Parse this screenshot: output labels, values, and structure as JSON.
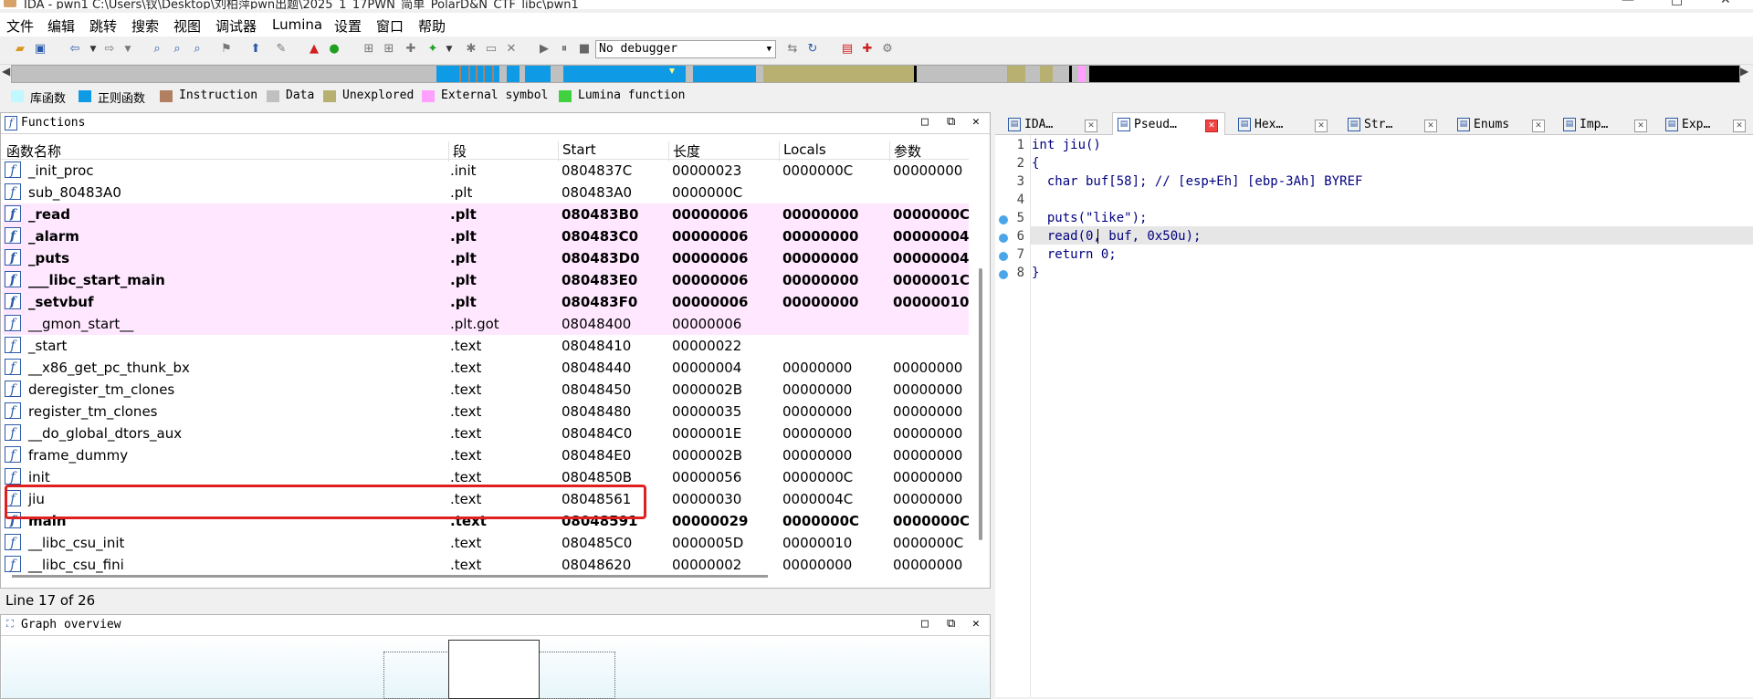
{
  "window": {
    "title": "IDA - pwn1 C:\\Users\\钗\\Desktop\\刘柏萍pwn出题\\2025_1_17PWN_简单_PolarD&N_CTF_libc\\pwn1",
    "min": "—",
    "max": "□",
    "close": "✕"
  },
  "menu": [
    "文件",
    "编辑",
    "跳转",
    "搜索",
    "视图",
    "调试器",
    "Lumina",
    "设置",
    "窗口",
    "帮助"
  ],
  "toolbar": {
    "debugger": "No debugger"
  },
  "legend": [
    {
      "label": "库函数",
      "color": "#bff8ff"
    },
    {
      "label": "正则函数",
      "color": "#0f9ae6"
    },
    {
      "label": "Instruction",
      "color": "#b08060"
    },
    {
      "label": "Data",
      "color": "#c0c0c0"
    },
    {
      "label": "Unexplored",
      "color": "#b8b070"
    },
    {
      "label": "External symbol",
      "color": "#ff9fff"
    },
    {
      "label": "Lumina function",
      "color": "#40d040"
    }
  ],
  "functions_panel": {
    "title": "Functions",
    "columns": [
      "函数名称",
      "段",
      "Start",
      "长度",
      "Locals",
      "参数"
    ],
    "rows": [
      {
        "name": "_init_proc",
        "seg": ".init",
        "start": "0804837C",
        "len": "00000023",
        "locals": "0000000C",
        "args": "00000000",
        "style": ""
      },
      {
        "name": "sub_80483A0",
        "seg": ".plt",
        "start": "080483A0",
        "len": "0000000C",
        "locals": "",
        "args": "",
        "style": ""
      },
      {
        "name": "_read",
        "seg": ".plt",
        "start": "080483B0",
        "len": "00000006",
        "locals": "00000000",
        "args": "0000000C",
        "style": "plt bold"
      },
      {
        "name": "_alarm",
        "seg": ".plt",
        "start": "080483C0",
        "len": "00000006",
        "locals": "00000000",
        "args": "00000004",
        "style": "plt bold"
      },
      {
        "name": "_puts",
        "seg": ".plt",
        "start": "080483D0",
        "len": "00000006",
        "locals": "00000000",
        "args": "00000004",
        "style": "plt bold"
      },
      {
        "name": "___libc_start_main",
        "seg": ".plt",
        "start": "080483E0",
        "len": "00000006",
        "locals": "00000000",
        "args": "0000001C",
        "style": "plt bold"
      },
      {
        "name": "_setvbuf",
        "seg": ".plt",
        "start": "080483F0",
        "len": "00000006",
        "locals": "00000000",
        "args": "00000010",
        "style": "plt bold"
      },
      {
        "name": "__gmon_start__",
        "seg": ".plt.got",
        "start": "08048400",
        "len": "00000006",
        "locals": "",
        "args": "",
        "style": "plt"
      },
      {
        "name": "_start",
        "seg": ".text",
        "start": "08048410",
        "len": "00000022",
        "locals": "",
        "args": "",
        "style": ""
      },
      {
        "name": "__x86_get_pc_thunk_bx",
        "seg": ".text",
        "start": "08048440",
        "len": "00000004",
        "locals": "00000000",
        "args": "00000000",
        "style": ""
      },
      {
        "name": "deregister_tm_clones",
        "seg": ".text",
        "start": "08048450",
        "len": "0000002B",
        "locals": "00000000",
        "args": "00000000",
        "style": ""
      },
      {
        "name": "register_tm_clones",
        "seg": ".text",
        "start": "08048480",
        "len": "00000035",
        "locals": "00000000",
        "args": "00000000",
        "style": ""
      },
      {
        "name": "__do_global_dtors_aux",
        "seg": ".text",
        "start": "080484C0",
        "len": "0000001E",
        "locals": "00000000",
        "args": "00000000",
        "style": ""
      },
      {
        "name": "frame_dummy",
        "seg": ".text",
        "start": "080484E0",
        "len": "0000002B",
        "locals": "00000000",
        "args": "00000000",
        "style": ""
      },
      {
        "name": "init",
        "seg": ".text",
        "start": "0804850B",
        "len": "00000056",
        "locals": "0000000C",
        "args": "00000000",
        "style": ""
      },
      {
        "name": "jiu",
        "seg": ".text",
        "start": "08048561",
        "len": "00000030",
        "locals": "0000004C",
        "args": "00000000",
        "style": ""
      },
      {
        "name": "main",
        "seg": ".text",
        "start": "08048591",
        "len": "00000029",
        "locals": "0000000C",
        "args": "0000000C",
        "style": "bold"
      },
      {
        "name": "__libc_csu_init",
        "seg": ".text",
        "start": "080485C0",
        "len": "0000005D",
        "locals": "00000010",
        "args": "0000000C",
        "style": ""
      },
      {
        "name": "__libc_csu_fini",
        "seg": ".text",
        "start": "08048620",
        "len": "00000002",
        "locals": "00000000",
        "args": "00000000",
        "style": ""
      }
    ],
    "status": "Line 17 of 26"
  },
  "graph_panel": {
    "title": "Graph overview"
  },
  "tabs": [
    {
      "label": "IDA…",
      "icon": "ida-view-icon",
      "active": false
    },
    {
      "label": "Pseud…",
      "icon": "pseudocode-icon",
      "active": true
    },
    {
      "label": "Hex…",
      "icon": "hex-view-icon",
      "active": false
    },
    {
      "label": "Str…",
      "icon": "strings-icon",
      "active": false
    },
    {
      "label": "Enums",
      "icon": "enums-icon",
      "active": false
    },
    {
      "label": "Imp…",
      "icon": "imports-icon",
      "active": false
    },
    {
      "label": "Exp…",
      "icon": "exports-icon",
      "active": false
    }
  ],
  "code": {
    "line_numbers": [
      "1",
      "2",
      "3",
      "4",
      "5",
      "6",
      "7",
      "8"
    ],
    "lines": [
      "int jiu()",
      "{",
      "  char buf[58]; // [esp+Eh] [ebp-3Ah] BYREF",
      "",
      "  puts(\"like\");",
      "  read(0, buf, 0x50u);",
      "  return 0;",
      "}"
    ]
  }
}
